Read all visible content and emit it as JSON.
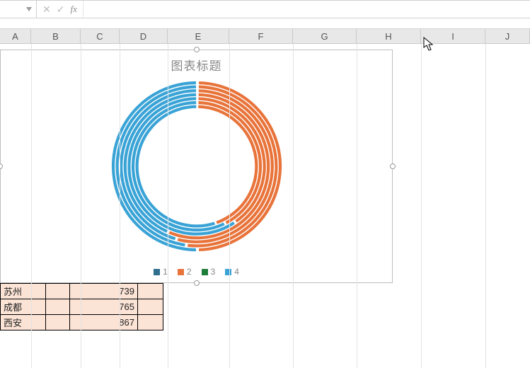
{
  "formula_bar": {
    "name_box": "",
    "formula": ""
  },
  "columns": [
    "A",
    "B",
    "C",
    "D",
    "E",
    "F",
    "G",
    "H",
    "I",
    "J"
  ],
  "column_edges": [
    0,
    44,
    114,
    169,
    237,
    324,
    414,
    504,
    595,
    686,
    749
  ],
  "chart": {
    "title": "图表标题",
    "legend": [
      {
        "label": "1",
        "color": "#2e6f8e"
      },
      {
        "label": "2",
        "color": "#e8743b"
      },
      {
        "label": "3",
        "color": "#1e7d3a"
      },
      {
        "label": "4",
        "color": "#3aa3d6"
      }
    ]
  },
  "chart_data": {
    "type": "pie",
    "note": "Multi-ring doughnut; values in degrees (360 total per ring), estimated from ring sweep. Color 1 = dark blue, 2 = orange, 3 = dark green, 4 = light blue.",
    "title": "图表标题",
    "legend_labels": [
      "1",
      "2",
      "3",
      "4"
    ],
    "colors": [
      "#2e6f8e",
      "#e8743b",
      "#1e7d3a",
      "#3aa3d6"
    ],
    "rings": [
      {
        "slices": [
          {
            "label": "1",
            "deg": 1
          },
          {
            "label": "2",
            "deg": 178
          },
          {
            "label": "3",
            "deg": 1
          },
          {
            "label": "4",
            "deg": 180
          }
        ]
      },
      {
        "slices": [
          {
            "label": "1",
            "deg": 1
          },
          {
            "label": "2",
            "deg": 186
          },
          {
            "label": "3",
            "deg": 1
          },
          {
            "label": "4",
            "deg": 172
          }
        ]
      },
      {
        "slices": [
          {
            "label": "1",
            "deg": 1
          },
          {
            "label": "2",
            "deg": 194
          },
          {
            "label": "3",
            "deg": 1
          },
          {
            "label": "4",
            "deg": 164
          }
        ]
      },
      {
        "slices": [
          {
            "label": "1",
            "deg": 1
          },
          {
            "label": "2",
            "deg": 202
          },
          {
            "label": "3",
            "deg": 1
          },
          {
            "label": "4",
            "deg": 156
          }
        ]
      },
      {
        "slices": [
          {
            "label": "1",
            "deg": 1
          },
          {
            "label": "2",
            "deg": 144
          },
          {
            "label": "3",
            "deg": 1
          },
          {
            "label": "4",
            "deg": 214
          }
        ]
      },
      {
        "slices": [
          {
            "label": "1",
            "deg": 1
          },
          {
            "label": "2",
            "deg": 152
          },
          {
            "label": "3",
            "deg": 1
          },
          {
            "label": "4",
            "deg": 206
          }
        ]
      },
      {
        "slices": [
          {
            "label": "1",
            "deg": 1
          },
          {
            "label": "2",
            "deg": 160
          },
          {
            "label": "3",
            "deg": 1
          },
          {
            "label": "4",
            "deg": 198
          }
        ]
      }
    ]
  },
  "table": {
    "rows": [
      {
        "city": "苏州",
        "value": "739"
      },
      {
        "city": "成都",
        "value": "765"
      },
      {
        "city": "西安",
        "value": "867"
      }
    ]
  }
}
